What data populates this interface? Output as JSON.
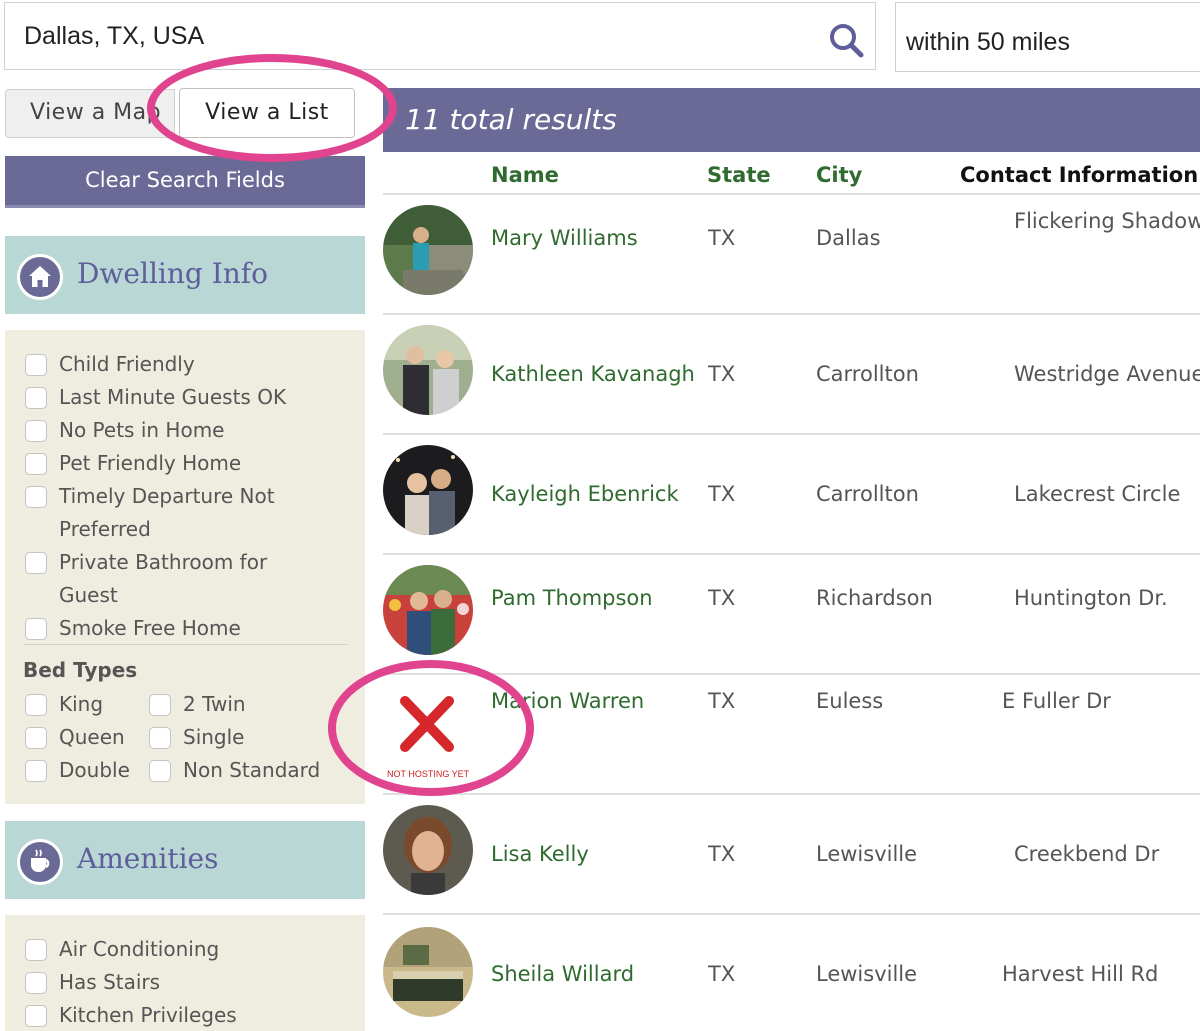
{
  "search": {
    "location_value": "Dallas, TX, USA",
    "radius_value": "within 50 miles"
  },
  "view_toggle": {
    "map_label": "View a Map",
    "list_label": "View a List"
  },
  "results": {
    "summary": "11 total results",
    "columns": [
      "Name",
      "State",
      "City",
      "Contact Information"
    ],
    "rows": [
      {
        "name": "Mary Williams",
        "state": "TX",
        "city": "Dallas",
        "contact": "Flickering Shadow"
      },
      {
        "name": "Kathleen Kavanagh",
        "state": "TX",
        "city": "Carrollton",
        "contact": "Westridge Avenue"
      },
      {
        "name": "Kayleigh Ebenrick",
        "state": "TX",
        "city": "Carrollton",
        "contact": "Lakecrest Circle"
      },
      {
        "name": "Pam Thompson",
        "state": "TX",
        "city": "Richardson",
        "contact": "Huntington Dr."
      },
      {
        "name": "Marion Warren",
        "state": "TX",
        "city": "Euless",
        "contact": "E Fuller Dr",
        "badge": "NOT HOSTING YET"
      },
      {
        "name": "Lisa Kelly",
        "state": "TX",
        "city": "Lewisville",
        "contact": "Creekbend Dr"
      },
      {
        "name": "Sheila Willard",
        "state": "TX",
        "city": "Lewisville",
        "contact": "Harvest Hill Rd"
      }
    ]
  },
  "sidebar": {
    "clear_label": "Clear Search Fields",
    "dwelling": {
      "title": "Dwelling Info",
      "icon": "home-icon",
      "options": [
        "Child Friendly",
        "Last Minute Guests OK",
        "No Pets in Home",
        "Pet Friendly Home",
        "Timely Departure Not Preferred",
        "Private Bathroom for Guest",
        "Smoke Free Home"
      ]
    },
    "bed_types": {
      "title": "Bed Types",
      "options": [
        "King",
        "2 Twin",
        "Queen",
        "Single",
        "Double",
        "Non Standard"
      ]
    },
    "amenities": {
      "title": "Amenities",
      "icon": "coffee-cup-icon",
      "options": [
        "Air Conditioning",
        "Has Stairs",
        "Kitchen Privileges"
      ]
    }
  },
  "colors": {
    "purple": "#6b6a97",
    "teal": "#b9d7d4",
    "beige": "#efece0",
    "green_text": "#2f6b2f",
    "highlight": "#e0448f"
  }
}
